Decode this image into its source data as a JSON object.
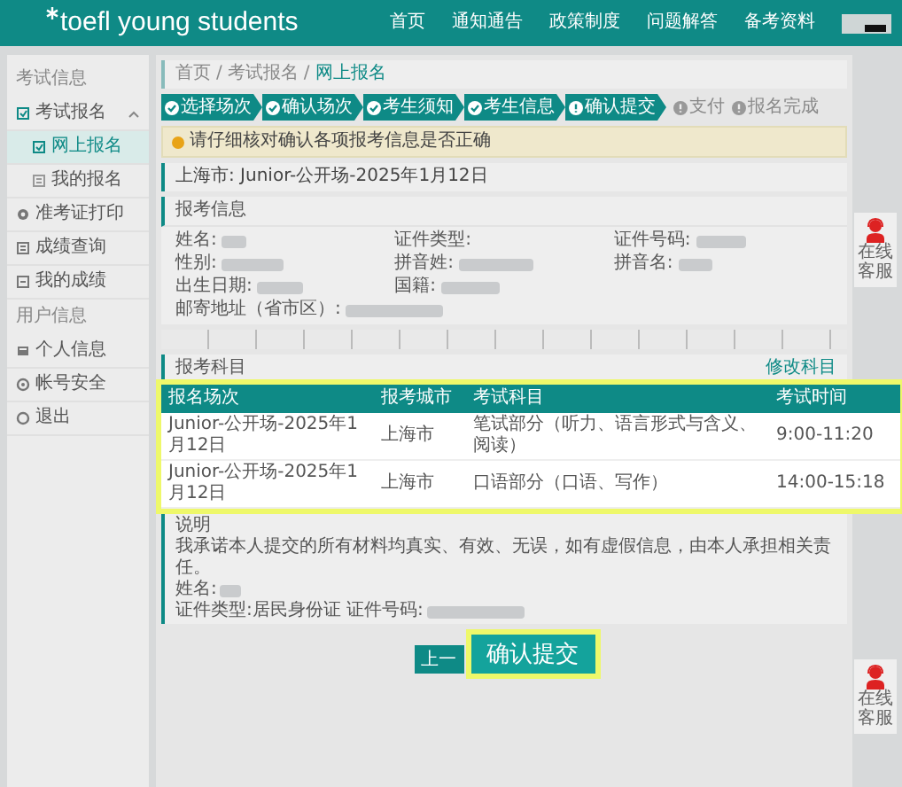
{
  "header": {
    "logo": "toefl young students",
    "nav": [
      {
        "label": "首页"
      },
      {
        "label": "通知通告"
      },
      {
        "label": "政策制度"
      },
      {
        "label": "问题解答"
      },
      {
        "label": "备考资料"
      }
    ]
  },
  "sidebar": {
    "groups": [
      {
        "title": "考试信息",
        "items": [
          {
            "label": "考试报名",
            "selected": false,
            "expanded": true,
            "children": [
              {
                "label": "网上报名",
                "selected": true
              },
              {
                "label": "我的报名",
                "selected": false
              }
            ]
          },
          {
            "label": "准考证打印",
            "selected": false
          },
          {
            "label": "成绩查询",
            "selected": false
          },
          {
            "label": "我的成绩",
            "selected": false
          }
        ]
      },
      {
        "title": "用户信息",
        "items": [
          {
            "label": "个人信息",
            "selected": false
          },
          {
            "label": "帐号安全",
            "selected": false
          },
          {
            "label": "退出",
            "selected": false
          }
        ]
      }
    ]
  },
  "breadcrumb": {
    "separator": "/",
    "items": [
      {
        "label": "首页"
      },
      {
        "label": "考试报名"
      },
      {
        "label": "网上报名"
      }
    ]
  },
  "steps": [
    {
      "label": "选择场次",
      "completed": true,
      "current": false
    },
    {
      "label": "确认场次",
      "completed": true,
      "current": false
    },
    {
      "label": "考生须知",
      "completed": true,
      "current": false
    },
    {
      "label": "考生信息",
      "completed": true,
      "current": false
    },
    {
      "label": "确认提交",
      "completed": false,
      "current": true
    },
    {
      "label": "支付",
      "completed": false,
      "current": false
    },
    {
      "label": "报名完成",
      "completed": false,
      "current": false
    }
  ],
  "notice": "请仔细核对确认各项报考信息是否正确",
  "session": "上海市: Junior-公开场-2025年1月12日",
  "info": {
    "title": "报考信息",
    "fields": [
      {
        "label": "姓名:",
        "redacted": true
      },
      {
        "label": "证件类型:",
        "redacted": false
      },
      {
        "label": "证件号码:",
        "redacted": true
      },
      {
        "label": "性别:",
        "redacted": true
      },
      {
        "label": "拼音姓:",
        "redacted": true
      },
      {
        "label": "拼音名:",
        "redacted": true
      },
      {
        "label": "出生日期:",
        "redacted": true
      },
      {
        "label": "国籍:",
        "redacted": true
      },
      {
        "label": "邮寄地址（省市区）:",
        "redacted": true,
        "wide": true
      }
    ]
  },
  "subjects": {
    "title": "报考科目",
    "link": "修改科目",
    "highlighted": true,
    "columns": [
      "报名场次",
      "报考城市",
      "考试科目",
      "考试时间"
    ],
    "rows": [
      [
        "Junior-公开场-2025年1月12日",
        "上海市",
        "笔试部分（听力、语言形式与含义、阅读）",
        "9:00-11:20"
      ],
      [
        "Junior-公开场-2025年1月12日",
        "上海市",
        "口语部分（口语、写作）",
        "14:00-15:18"
      ]
    ]
  },
  "declaration": {
    "title": "说明",
    "lines": [
      {
        "text": "我承诺本人提交的所有材料均真实、有效、无误，如有虚假信息，由本人承担相关责任。",
        "redacted": false
      },
      {
        "text": "姓名:",
        "redacted": true
      },
      {
        "text": "证件类型:居民身份证 证件号码:",
        "redacted": true
      }
    ]
  },
  "buttons": [
    {
      "label": "上一",
      "kind": "secondary",
      "highlighted": false
    },
    {
      "label": "确认提交",
      "kind": "primary",
      "highlighted": true
    }
  ],
  "float_buttons": [
    {
      "label": "在线客服"
    },
    {
      "label": "在线客服"
    }
  ]
}
